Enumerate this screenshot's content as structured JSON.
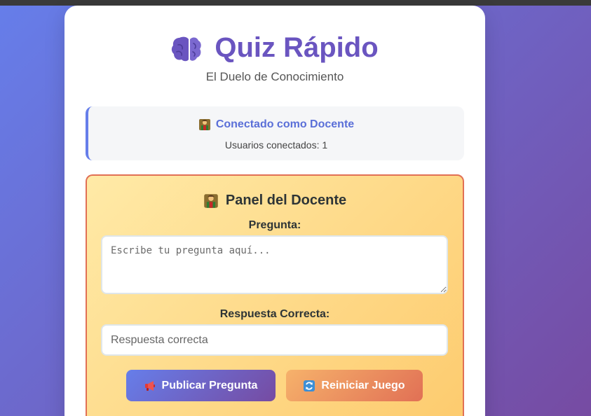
{
  "header": {
    "title": "Quiz Rápido",
    "subtitle": "El Duelo de Conocimiento",
    "icon": "brain-icon"
  },
  "status": {
    "connected_label": "Conectado como Docente",
    "users_label": "Usuarios conectados: 1",
    "icon": "teacher-icon"
  },
  "teacher_panel": {
    "title": "Panel del Docente",
    "question_label": "Pregunta:",
    "question_placeholder": "Escribe tu pregunta aquí...",
    "question_value": "",
    "answer_label": "Respuesta Correcta:",
    "answer_placeholder": "Respuesta correcta",
    "answer_value": "",
    "publish_button": "Publicar Pregunta",
    "reset_button": "Reiniciar Juego",
    "publish_icon": "megaphone-icon",
    "reset_icon": "refresh-icon"
  },
  "colors": {
    "accent": "#667eea",
    "accent_dark": "#764ba2",
    "title": "#6a55c0",
    "panel_border": "#e17055",
    "panel_bg_start": "#ffeaa7",
    "panel_bg_end": "#fdcb6e"
  }
}
